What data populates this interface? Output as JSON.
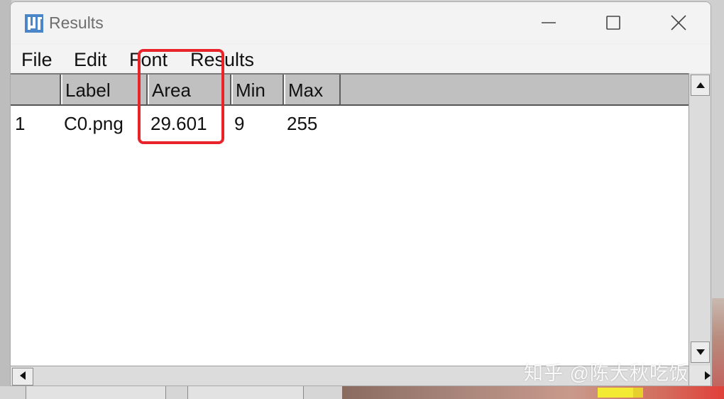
{
  "window": {
    "title": "Results",
    "app_icon": "imagej-icon"
  },
  "titlebar_buttons": [
    "minimize-icon",
    "maximize-icon",
    "close-icon"
  ],
  "menu": [
    "File",
    "Edit",
    "Font",
    "Results"
  ],
  "table": {
    "columns": [
      "",
      "Label",
      "Area",
      "Min",
      "Max"
    ],
    "rows": [
      [
        "1",
        "C0.png",
        "29.601",
        "9",
        "255"
      ]
    ]
  },
  "annotation": {
    "color": "#e8242a",
    "target": "Area"
  },
  "watermark": "知乎 @陈大秋吃饭"
}
